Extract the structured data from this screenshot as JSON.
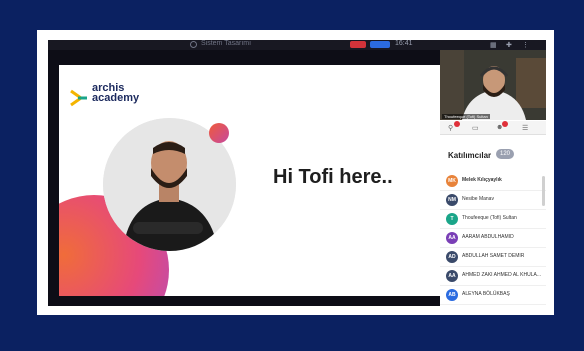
{
  "topbar": {
    "meeting_label": "Sistem Tasarımı",
    "right_label": "16:41"
  },
  "slide": {
    "logo_line1": "archis",
    "logo_line2": "academy",
    "headline": "Hi Tofi here.."
  },
  "video": {
    "participant_name": "Thoufeeque (Tofi) Sultan"
  },
  "participants": {
    "title": "Katılımcılar",
    "count": "120",
    "items": [
      {
        "initials": "MK",
        "name": "Melek Kılıçyaylık",
        "color": "#e8833a",
        "bold": true
      },
      {
        "initials": "NM",
        "name": "Nesibe Manav",
        "color": "#3a4a6a",
        "bold": false
      },
      {
        "initials": "T",
        "name": "Thoufeeque (Tofi) Sultan",
        "color": "#1aa589",
        "bold": false
      },
      {
        "initials": "AA",
        "name": "AARAM ABDULHAMID",
        "color": "#7a3fb6",
        "bold": false
      },
      {
        "initials": "AD",
        "name": "ABDULLAH SAMET DEMIR",
        "color": "#3a4a6a",
        "bold": false
      },
      {
        "initials": "AA",
        "name": "AHMED ZAKI AHMED AL KHULA...",
        "color": "#3a4a6a",
        "bold": false
      },
      {
        "initials": "AB",
        "name": "ALEYNA BÖLÜKBAŞ",
        "color": "#2b6be0",
        "bold": false
      }
    ]
  }
}
